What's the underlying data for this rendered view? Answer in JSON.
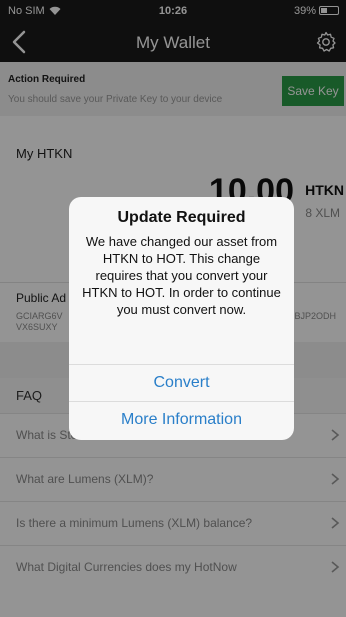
{
  "status_bar": {
    "carrier": "No SIM",
    "time": "10:26",
    "battery": "39%",
    "battery_level": 0.39
  },
  "nav": {
    "title": "My Wallet"
  },
  "action_required": {
    "heading": "Action Required",
    "message": "You should save your Private Key to your device",
    "button_label": "Save Key"
  },
  "balance": {
    "label": "My HTKN",
    "amount": "10.00",
    "currency": "HTKN",
    "xlm": "8 XLM"
  },
  "public_address": {
    "label": "Public Ad",
    "value_line1": "GCIARG6V",
    "value_line2": "VX6SUXY",
    "value_right": "BJP2ODH"
  },
  "faq": {
    "heading": "FAQ",
    "items": [
      "What is Stellar?",
      "What are Lumens (XLM)?",
      "Is there a minimum Lumens (XLM) balance?",
      "What Digital Currencies does my HotNow"
    ]
  },
  "dialog": {
    "title": "Update Required",
    "message": "We have changed our asset from HTKN to HOT. This change requires that you convert your HTKN to HOT. In order to continue you must convert now.",
    "convert_label": "Convert",
    "more_info_label": "More Information"
  },
  "colors": {
    "accent": "#2a7fc9",
    "save_button": "#2a9c47",
    "navbar": "#1b1b1b"
  }
}
